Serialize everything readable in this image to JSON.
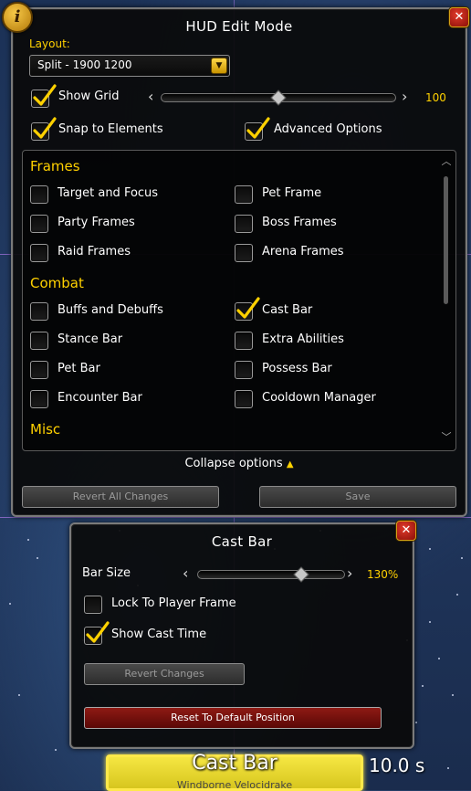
{
  "main": {
    "title": "HUD Edit Mode",
    "layout_label": "Layout:",
    "layout_value": "Split - 1900 1200",
    "show_grid_label": "Show Grid",
    "show_grid_checked": true,
    "grid_value": "100",
    "grid_slider_level": 0.5,
    "snap_label": "Snap to Elements",
    "snap_checked": true,
    "advanced_label": "Advanced Options",
    "advanced_checked": true,
    "sections": {
      "frames": "Frames",
      "combat": "Combat",
      "misc": "Misc"
    },
    "frames_items": [
      {
        "label": "Target and Focus",
        "checked": false
      },
      {
        "label": "Pet Frame",
        "checked": false
      },
      {
        "label": "Party Frames",
        "checked": false
      },
      {
        "label": "Boss Frames",
        "checked": false
      },
      {
        "label": "Raid Frames",
        "checked": false
      },
      {
        "label": "Arena Frames",
        "checked": false
      }
    ],
    "combat_items": [
      {
        "label": "Buffs and Debuffs",
        "checked": false
      },
      {
        "label": "Cast Bar",
        "checked": true
      },
      {
        "label": "Stance Bar",
        "checked": false
      },
      {
        "label": "Extra Abilities",
        "checked": false
      },
      {
        "label": "Pet Bar",
        "checked": false
      },
      {
        "label": "Possess Bar",
        "checked": false
      },
      {
        "label": "Encounter Bar",
        "checked": false
      },
      {
        "label": "Cooldown Manager",
        "checked": false
      }
    ],
    "collapse_label": "Collapse options",
    "revert_all_label": "Revert All Changes",
    "save_label": "Save"
  },
  "cast_settings": {
    "title": "Cast Bar",
    "bar_size_label": "Bar Size",
    "bar_size_value": "130%",
    "bar_size_level": 0.72,
    "lock_label": "Lock To Player Frame",
    "lock_checked": false,
    "show_time_label": "Show Cast Time",
    "show_time_checked": true,
    "revert_label": "Revert Changes",
    "reset_label": "Reset To Default Position"
  },
  "castbar_preview": {
    "name": "Cast Bar",
    "spell": "Windborne Velocidrake",
    "time": "10.0 s"
  },
  "colors": {
    "accent_gold": "#ffd100",
    "close_red": "#c0261a",
    "reset_red": "#7a110c",
    "castbar_yellow": "#f5e642"
  },
  "icons": {
    "info": "info-icon",
    "close": "close-icon",
    "check": "checkmark-icon",
    "dropdown": "chevron-down-icon"
  }
}
